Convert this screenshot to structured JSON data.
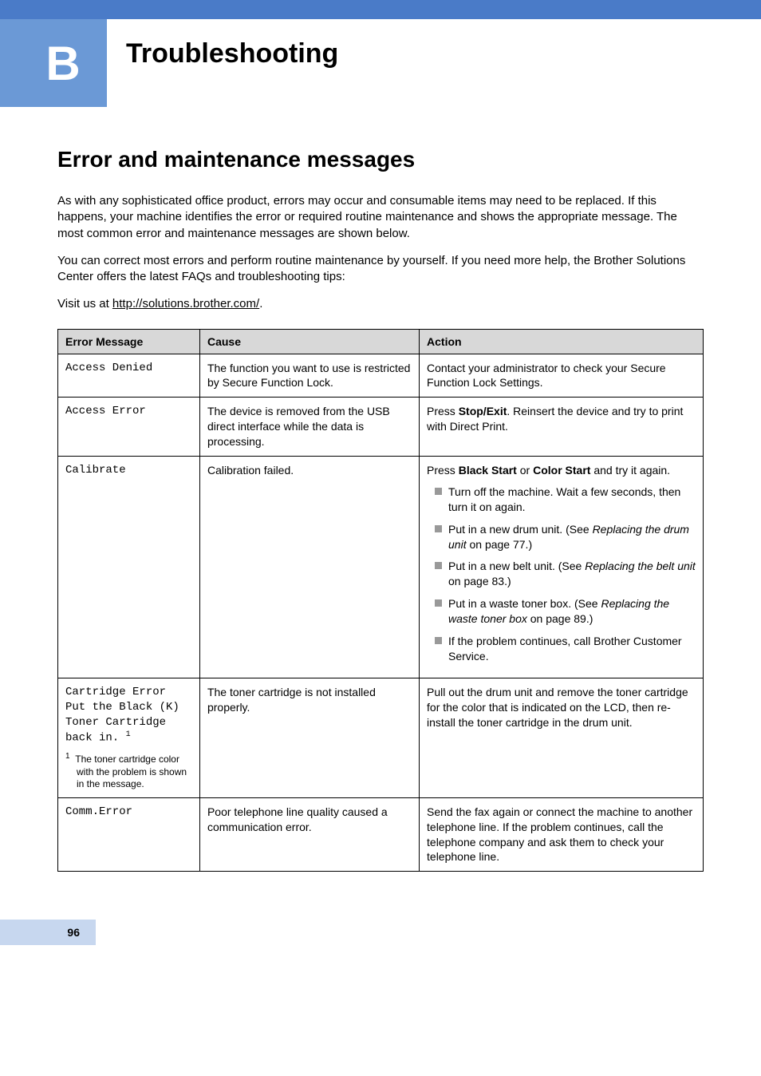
{
  "header": {
    "appendix_letter": "B",
    "title": "Troubleshooting"
  },
  "section": {
    "heading": "Error and maintenance messages",
    "para1": "As with any sophisticated office product, errors may occur and consumable items may need to be replaced. If this happens, your machine identifies the error or required routine maintenance and shows the appropriate message. The most common error and maintenance messages are shown below.",
    "para2": "You can correct most errors and perform routine maintenance by yourself. If you need more help, the Brother Solutions Center offers the latest FAQs and troubleshooting tips:",
    "visit_prefix": "Visit us at ",
    "visit_link": "http://solutions.brother.com/",
    "visit_suffix": "."
  },
  "table": {
    "headers": {
      "col1": "Error Message",
      "col2": "Cause",
      "col3": "Action"
    },
    "rows": {
      "r1": {
        "msg": "Access Denied",
        "cause": "The function you want to use is restricted by Secure Function Lock.",
        "action": "Contact your administrator to check your Secure Function Lock Settings."
      },
      "r2": {
        "msg": "Access Error",
        "cause": "The device is removed from the USB direct interface while the data is processing.",
        "action_prefix": "Press ",
        "action_bold": "Stop/Exit",
        "action_suffix": ". Reinsert the device and try to print with Direct Print."
      },
      "r3": {
        "msg": "Calibrate",
        "cause": "Calibration failed.",
        "action_line": {
          "prefix": "Press ",
          "b1": "Black Start",
          "mid": " or ",
          "b2": "Color Start",
          "suffix": " and try it again."
        },
        "items": {
          "i1": "Turn off the machine. Wait a few seconds, then turn it on again.",
          "i2_prefix": "Put in a new drum unit. (See ",
          "i2_italic": "Replacing the drum unit",
          "i2_suffix": " on page 77.)",
          "i3_prefix": "Put in a new belt unit. (See ",
          "i3_italic": "Replacing the belt unit",
          "i3_suffix": " on page 83.)",
          "i4_prefix": "Put in a waste toner box. (See ",
          "i4_italic": "Replacing the waste toner box",
          "i4_suffix": " on page 89.)",
          "i5": "If the problem continues, call Brother Customer Service."
        }
      },
      "r4": {
        "msg_l1": "Cartridge Error",
        "msg_l2": "Put the Black (K) Toner Cartridge back in.",
        "footnote_num": "1",
        "footnote_text": "The toner cartridge color with the problem is shown in the message.",
        "cause": "The toner cartridge is not installed properly.",
        "action": "Pull out the drum unit and remove the toner cartridge for the color that is indicated on the LCD, then re-install the toner cartridge in the drum unit."
      },
      "r5": {
        "msg": "Comm.Error",
        "cause": "Poor telephone line quality caused a communication error.",
        "action": "Send the fax again or connect the machine to another telephone line. If the problem continues, call the telephone company and ask them to check your telephone line."
      }
    }
  },
  "footer": {
    "page_number": "96"
  }
}
